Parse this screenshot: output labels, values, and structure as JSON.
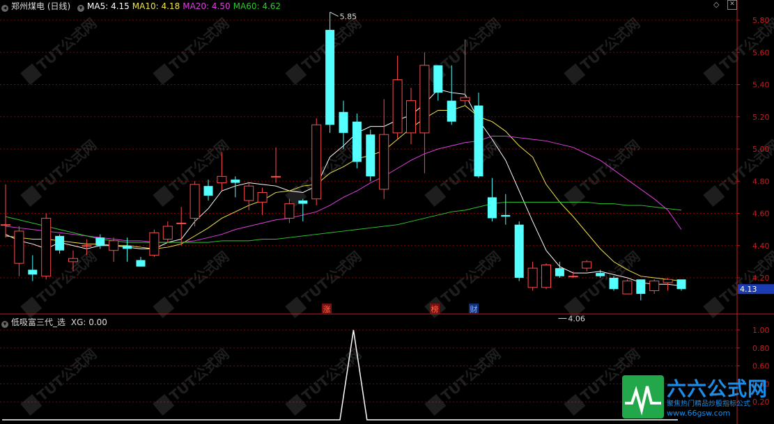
{
  "header": {
    "title": "郑州煤电 (日线)",
    "ma_items": [
      {
        "label": "MA5: 4.15",
        "color": "#ffffff"
      },
      {
        "label": "MA10: 4.18",
        "color": "#f2e64a"
      },
      {
        "label": "MA20: 4.50",
        "color": "#e040e0"
      },
      {
        "label": "MA60: 4.62",
        "color": "#2ec92e"
      }
    ]
  },
  "indicator_header": {
    "name": "低吸富三代_选",
    "value_label": "XG: 0.00"
  },
  "price_axis": {
    "ticks": [
      "5.80",
      "5.60",
      "5.40",
      "5.20",
      "5.00",
      "4.80",
      "4.60",
      "4.40",
      "4.20"
    ],
    "current_price": "4.13"
  },
  "indicator_axis": {
    "ticks": [
      "1.00",
      "0.80",
      "0.60",
      "0.40",
      "0.20"
    ]
  },
  "annotations": {
    "high_label": "5.85",
    "low_label": "4.06",
    "event_marks": [
      "涨",
      "榜",
      "财"
    ]
  },
  "watermark": {
    "brand": "六六公式网",
    "slogan": "聚焦热门精品炒股指标公式",
    "url": "www.66gsw.com"
  },
  "colors": {
    "up": "#ff4c4c",
    "down": "#54ffff",
    "ma5": "#ffffff",
    "ma10": "#f2e64a",
    "ma20": "#e040e0",
    "ma60": "#2ec92e",
    "grid": "#8b0000",
    "axis": "#c81e1e"
  },
  "chart_data": [
    {
      "type": "candlestick",
      "title": "郑州煤电 (日线)",
      "ylim": [
        4.06,
        5.85
      ],
      "y_ticks": [
        4.2,
        4.4,
        4.6,
        4.8,
        5.0,
        5.2,
        5.4,
        5.6,
        5.8
      ],
      "candles": [
        {
          "o": 4.53,
          "c": 4.53,
          "h": 4.78,
          "l": 4.45
        },
        {
          "o": 4.29,
          "c": 4.49,
          "h": 4.52,
          "l": 4.21
        },
        {
          "o": 4.25,
          "c": 4.22,
          "h": 4.34,
          "l": 4.18
        },
        {
          "o": 4.21,
          "c": 4.57,
          "h": 4.6,
          "l": 4.19
        },
        {
          "o": 4.46,
          "c": 4.37,
          "h": 4.47,
          "l": 4.35
        },
        {
          "o": 4.3,
          "c": 4.32,
          "h": 4.37,
          "l": 4.24
        },
        {
          "o": 4.4,
          "c": 4.4,
          "h": 4.44,
          "l": 4.34
        },
        {
          "o": 4.45,
          "c": 4.4,
          "h": 4.47,
          "l": 4.38
        },
        {
          "o": 4.37,
          "c": 4.43,
          "h": 4.45,
          "l": 4.3
        },
        {
          "o": 4.4,
          "c": 4.38,
          "h": 4.45,
          "l": 4.3
        },
        {
          "o": 4.31,
          "c": 4.27,
          "h": 4.33,
          "l": 4.27
        },
        {
          "o": 4.34,
          "c": 4.48,
          "h": 4.5,
          "l": 4.33
        },
        {
          "o": 4.44,
          "c": 4.52,
          "h": 4.55,
          "l": 4.42
        },
        {
          "o": 4.54,
          "c": 4.54,
          "h": 4.64,
          "l": 4.4
        },
        {
          "o": 4.57,
          "c": 4.78,
          "h": 4.8,
          "l": 4.52
        },
        {
          "o": 4.77,
          "c": 4.71,
          "h": 4.81,
          "l": 4.68
        },
        {
          "o": 4.79,
          "c": 4.83,
          "h": 4.98,
          "l": 4.74
        },
        {
          "o": 4.81,
          "c": 4.79,
          "h": 4.83,
          "l": 4.7
        },
        {
          "o": 4.68,
          "c": 4.77,
          "h": 4.79,
          "l": 4.62
        },
        {
          "o": 4.67,
          "c": 4.73,
          "h": 4.76,
          "l": 4.59
        },
        {
          "o": 4.83,
          "c": 4.83,
          "h": 5.01,
          "l": 4.79
        },
        {
          "o": 4.57,
          "c": 4.66,
          "h": 4.69,
          "l": 4.54
        },
        {
          "o": 4.68,
          "c": 4.66,
          "h": 4.69,
          "l": 4.55
        },
        {
          "o": 4.69,
          "c": 5.15,
          "h": 5.19,
          "l": 4.65
        },
        {
          "o": 5.74,
          "c": 5.15,
          "h": 5.85,
          "l": 5.1
        },
        {
          "o": 5.23,
          "c": 5.1,
          "h": 5.3,
          "l": 5.0
        },
        {
          "o": 5.17,
          "c": 4.92,
          "h": 5.22,
          "l": 4.88
        },
        {
          "o": 5.09,
          "c": 4.83,
          "h": 5.12,
          "l": 4.8
        },
        {
          "o": 4.75,
          "c": 5.09,
          "h": 5.31,
          "l": 4.69
        },
        {
          "o": 5.1,
          "c": 5.43,
          "h": 5.58,
          "l": 5.06
        },
        {
          "o": 5.1,
          "c": 5.3,
          "h": 5.38,
          "l": 5.03
        },
        {
          "o": 5.1,
          "c": 5.52,
          "h": 5.6,
          "l": 4.85
        },
        {
          "o": 5.52,
          "c": 5.35,
          "h": 5.52,
          "l": 5.3
        },
        {
          "o": 5.3,
          "c": 5.17,
          "h": 5.52,
          "l": 5.15
        },
        {
          "o": 5.3,
          "c": 5.32,
          "h": 5.68,
          "l": 5.27
        },
        {
          "o": 5.27,
          "c": 4.83,
          "h": 5.35,
          "l": 4.82
        },
        {
          "o": 4.7,
          "c": 4.57,
          "h": 4.82,
          "l": 4.55
        },
        {
          "o": 4.59,
          "c": 4.58,
          "h": 4.72,
          "l": 4.53
        },
        {
          "o": 4.53,
          "c": 4.2,
          "h": 4.55,
          "l": 4.18
        },
        {
          "o": 4.14,
          "c": 4.26,
          "h": 4.3,
          "l": 4.12
        },
        {
          "o": 4.14,
          "c": 4.28,
          "h": 4.29,
          "l": 4.13
        },
        {
          "o": 4.26,
          "c": 4.21,
          "h": 4.3,
          "l": 4.2
        },
        {
          "o": 4.21,
          "c": 4.21,
          "h": 4.24,
          "l": 4.2
        },
        {
          "o": 4.26,
          "c": 4.3,
          "h": 4.31,
          "l": 4.24
        },
        {
          "o": 4.23,
          "c": 4.21,
          "h": 4.25,
          "l": 4.2
        },
        {
          "o": 4.2,
          "c": 4.13,
          "h": 4.21,
          "l": 4.12
        },
        {
          "o": 4.1,
          "c": 4.18,
          "h": 4.19,
          "l": 4.1
        },
        {
          "o": 4.19,
          "c": 4.1,
          "h": 4.19,
          "l": 4.06
        },
        {
          "o": 4.12,
          "c": 4.18,
          "h": 4.19,
          "l": 4.1
        },
        {
          "o": 4.17,
          "c": 4.19,
          "h": 4.2,
          "l": 4.12
        },
        {
          "o": 4.19,
          "c": 4.13,
          "h": 4.19,
          "l": 4.12
        }
      ],
      "series": [
        {
          "name": "MA5",
          "values": [
            4.47,
            4.43,
            4.41,
            4.38,
            4.42,
            4.4,
            4.38,
            4.4,
            4.4,
            4.39,
            4.38,
            4.38,
            4.42,
            4.44,
            4.55,
            4.63,
            4.74,
            4.77,
            4.79,
            4.78,
            4.77,
            4.74,
            4.73,
            4.77,
            4.95,
            5.02,
            5.1,
            5.14,
            5.14,
            5.18,
            5.21,
            5.28,
            5.37,
            5.35,
            5.34,
            5.18,
            5.06,
            4.93,
            4.74,
            4.55,
            4.37,
            4.27,
            4.23,
            4.23,
            4.24,
            4.22,
            4.2,
            4.17,
            4.16,
            4.16,
            4.15
          ]
        },
        {
          "name": "MA10",
          "values": [
            4.46,
            4.45,
            4.44,
            4.44,
            4.43,
            4.42,
            4.41,
            4.41,
            4.4,
            4.4,
            4.39,
            4.38,
            4.39,
            4.41,
            4.46,
            4.51,
            4.57,
            4.61,
            4.65,
            4.68,
            4.73,
            4.74,
            4.77,
            4.78,
            4.85,
            4.89,
            4.94,
            4.96,
            4.99,
            5.06,
            5.13,
            5.19,
            5.24,
            5.24,
            5.27,
            5.2,
            5.17,
            5.11,
            5.02,
            4.95,
            4.78,
            4.67,
            4.58,
            4.48,
            4.38,
            4.3,
            4.25,
            4.21,
            4.2,
            4.19,
            4.18
          ]
        },
        {
          "name": "MA20",
          "values": [
            4.52,
            4.51,
            4.5,
            4.49,
            4.48,
            4.47,
            4.46,
            4.45,
            4.44,
            4.43,
            4.43,
            4.42,
            4.42,
            4.42,
            4.43,
            4.45,
            4.47,
            4.5,
            4.52,
            4.54,
            4.56,
            4.57,
            4.59,
            4.61,
            4.65,
            4.7,
            4.74,
            4.79,
            4.83,
            4.88,
            4.93,
            4.97,
            5.0,
            5.02,
            5.04,
            5.05,
            5.08,
            5.08,
            5.07,
            5.06,
            5.05,
            5.03,
            5.01,
            4.97,
            4.93,
            4.87,
            4.81,
            4.75,
            4.69,
            4.62,
            4.5
          ]
        },
        {
          "name": "MA60",
          "values": [
            4.58,
            4.56,
            4.54,
            4.52,
            4.5,
            4.48,
            4.46,
            4.44,
            4.43,
            4.42,
            4.42,
            4.42,
            4.42,
            4.42,
            4.42,
            4.42,
            4.43,
            4.43,
            4.43,
            4.44,
            4.44,
            4.45,
            4.46,
            4.47,
            4.48,
            4.49,
            4.5,
            4.51,
            4.52,
            4.53,
            4.55,
            4.57,
            4.59,
            4.61,
            4.62,
            4.64,
            4.66,
            4.67,
            4.67,
            4.67,
            4.67,
            4.67,
            4.67,
            4.67,
            4.66,
            4.66,
            4.65,
            4.65,
            4.64,
            4.63,
            4.62
          ]
        }
      ],
      "high_label": "5.85",
      "low_label": "4.06"
    },
    {
      "type": "line",
      "title": "低吸富三代_选",
      "ylim": [
        0,
        1.1
      ],
      "y_ticks": [
        0.2,
        0.4,
        0.6,
        0.8,
        1.0
      ],
      "series": [
        {
          "name": "XG",
          "values": [
            0,
            0,
            0,
            0,
            0,
            0,
            0,
            0,
            0,
            0,
            0,
            0,
            0,
            0,
            0,
            0,
            0,
            0,
            0,
            0,
            0,
            0,
            0,
            0,
            0,
            0,
            1,
            0,
            0,
            0,
            0,
            0,
            0,
            0,
            0,
            0,
            0,
            0,
            0,
            0,
            0,
            0,
            0,
            0,
            0,
            0,
            0,
            0,
            0,
            0,
            0
          ]
        }
      ]
    }
  ]
}
